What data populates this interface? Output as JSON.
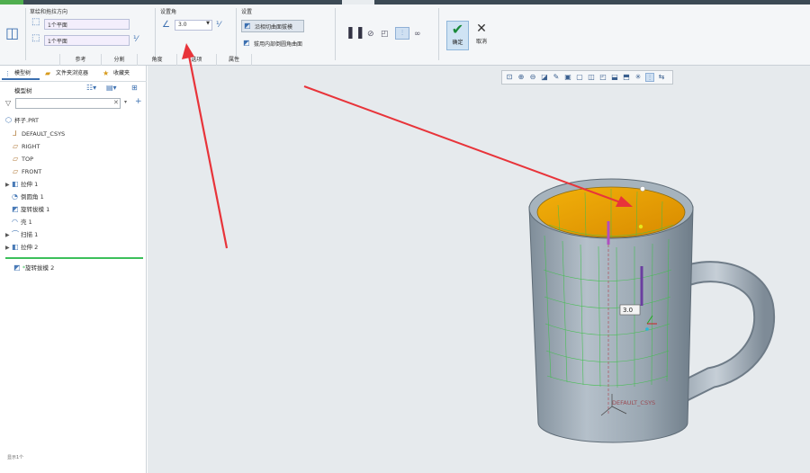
{
  "ribbon": {
    "group1_title": "草绘和拖拉方向",
    "field1_value": "1个平面",
    "field2_value": "1个平面",
    "group2_title": "设置角",
    "angle_value": "3.0",
    "group3_title": "设置",
    "btn_round": "沿相切曲面拔模",
    "btn_internal": "拔用内部倒圆角曲面",
    "ok_label": "确定",
    "cancel_label": "取消",
    "subtabs": [
      "参考",
      "分割",
      "角度",
      "选项",
      "属性"
    ]
  },
  "left_panel": {
    "tabs": [
      "模型树",
      "文件夹浏览器",
      "收藏夹"
    ],
    "tree_title": "模型树",
    "search_placeholder": "",
    "items": [
      {
        "label": "杯子.PRT",
        "icon": "part-icon"
      },
      {
        "label": "DEFAULT_CSYS",
        "icon": "csys-icon"
      },
      {
        "label": "RIGHT",
        "icon": "plane-icon"
      },
      {
        "label": "TOP",
        "icon": "plane-icon"
      },
      {
        "label": "FRONT",
        "icon": "plane-icon"
      },
      {
        "label": "拉伸 1",
        "icon": "extrude-icon"
      },
      {
        "label": "倒圆角 1",
        "icon": "round-icon"
      },
      {
        "label": "旋转拔模 1",
        "icon": "draft-icon"
      },
      {
        "label": "壳 1",
        "icon": "shell-icon"
      },
      {
        "label": "扫描 1",
        "icon": "sweep-icon"
      },
      {
        "label": "拉伸 2",
        "icon": "extrude-icon"
      }
    ],
    "insert_item": "旋转拔模 2",
    "status_text": "显示1个"
  },
  "viewport": {
    "csys_label": "DEFAULT_CSYS",
    "dim_label": "3.0",
    "colors": {
      "rim": "#e8a000",
      "body": "#9aa7b2",
      "annotation_arrow": "#e8343a"
    }
  }
}
